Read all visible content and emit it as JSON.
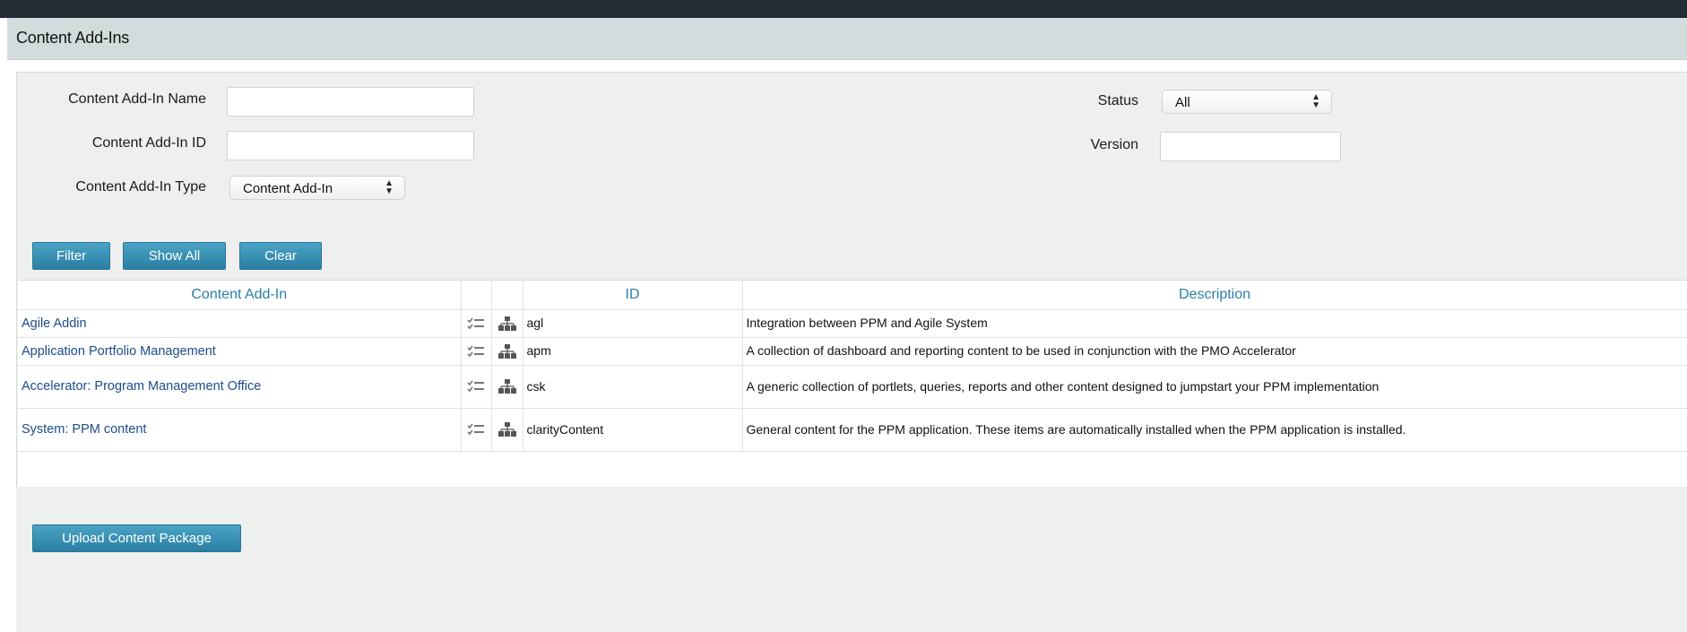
{
  "page": {
    "title": "Content Add-Ins"
  },
  "filters": {
    "name_label": "Content Add-In Name",
    "name_value": "",
    "id_label": "Content Add-In ID",
    "id_value": "",
    "type_label": "Content Add-In Type",
    "type_selected": "Content Add-In",
    "status_label": "Status",
    "status_selected": "All",
    "version_label": "Version",
    "version_value": ""
  },
  "buttons": {
    "filter": "Filter",
    "show_all": "Show All",
    "clear": "Clear",
    "upload": "Upload Content Package"
  },
  "table": {
    "headers": {
      "name": "Content Add-In",
      "id": "ID",
      "description": "Description"
    },
    "rows": [
      {
        "name": "Agile Addin",
        "id": "agl",
        "description": "Integration between PPM and Agile System"
      },
      {
        "name": "Application Portfolio Management",
        "id": "apm",
        "description": "A collection of dashboard and reporting content to be used in conjunction with the PMO Accelerator"
      },
      {
        "name": "Accelerator: Program Management Office",
        "id": "csk",
        "description": "A generic collection of portlets, queries, reports and other content designed to jumpstart your PPM implementation"
      },
      {
        "name": "System: PPM content",
        "id": "clarityContent",
        "description": "General content for the PPM application. These items are automatically installed when the PPM application is installed."
      }
    ]
  },
  "colors": {
    "accent": "#2b7fa8",
    "button": "#3a91b5",
    "link": "#1d4c8c",
    "header_bar": "#222c35",
    "title_bar": "#d3dcdc"
  }
}
